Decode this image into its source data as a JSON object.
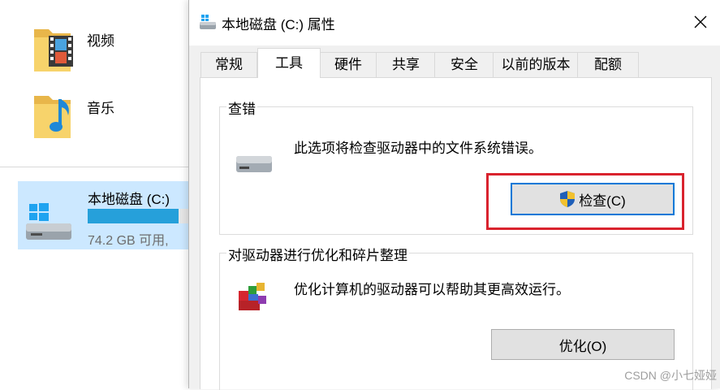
{
  "explorer": {
    "folders": [
      {
        "label": "视频",
        "icon": "video-folder-icon"
      },
      {
        "label": "音乐",
        "icon": "music-folder-icon"
      }
    ],
    "drive": {
      "name": "本地磁盘 (C:)",
      "free_text": "74.2 GB 可用,",
      "usage_fraction": 0.85,
      "icon": "windows-drive-icon"
    }
  },
  "dialog": {
    "title": "本地磁盘 (C:) 属性",
    "close_icon": "close-icon",
    "tabs": [
      {
        "label": "常规"
      },
      {
        "label": "工具",
        "active": true
      },
      {
        "label": "硬件"
      },
      {
        "label": "共享"
      },
      {
        "label": "安全"
      },
      {
        "label": "以前的版本"
      },
      {
        "label": "配额"
      }
    ],
    "error_check": {
      "title": "查错",
      "description": "此选项将检查驱动器中的文件系统错误。",
      "button": "检查(C)",
      "button_icon": "uac-shield-icon",
      "highlight_color": "#d9232e"
    },
    "optimize": {
      "title": "对驱动器进行优化和碎片整理",
      "description": "优化计算机的驱动器可以帮助其更高效运行。",
      "button": "优化(O)"
    }
  },
  "watermark": "CSDN @小七娅娅",
  "colors": {
    "accent": "#0078d7",
    "selection": "#cce8ff",
    "progress": "#26a0da",
    "annotation": "#d9232e"
  }
}
